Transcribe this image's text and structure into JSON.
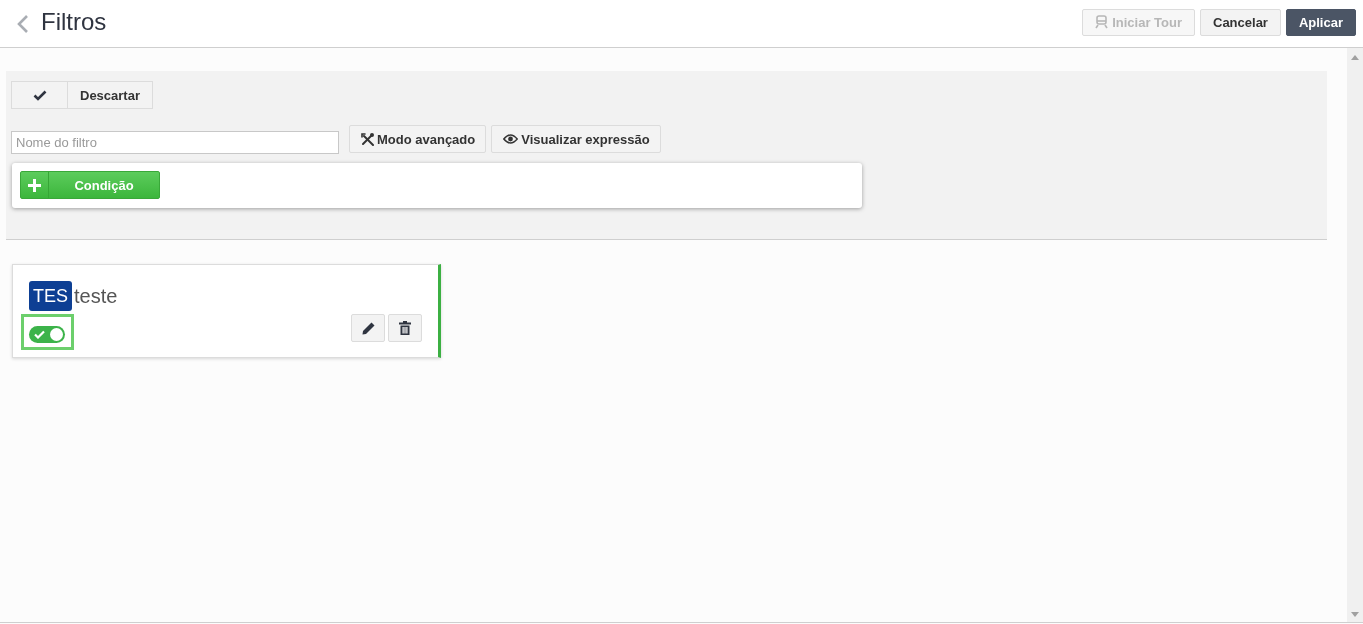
{
  "header": {
    "title": "Filtros",
    "buttons": [
      {
        "label": "Iniciar Tour",
        "kind": "tour",
        "disabled": true
      },
      {
        "label": "Cancelar",
        "kind": "default",
        "disabled": false
      },
      {
        "label": "Aplicar",
        "kind": "primary",
        "disabled": false
      }
    ]
  },
  "editor": {
    "discard_label": "Descartar",
    "name_field": {
      "placeholder": "Nome do filtro"
    },
    "tools": [
      {
        "label": "Modo avançado",
        "kind": "advanced"
      },
      {
        "label": "Visualizar expressão",
        "kind": "preview"
      }
    ],
    "add_condition_label": "Condição"
  },
  "filters": [
    {
      "tag": "TES",
      "name": "teste",
      "enabled": true,
      "focused": true
    }
  ]
}
